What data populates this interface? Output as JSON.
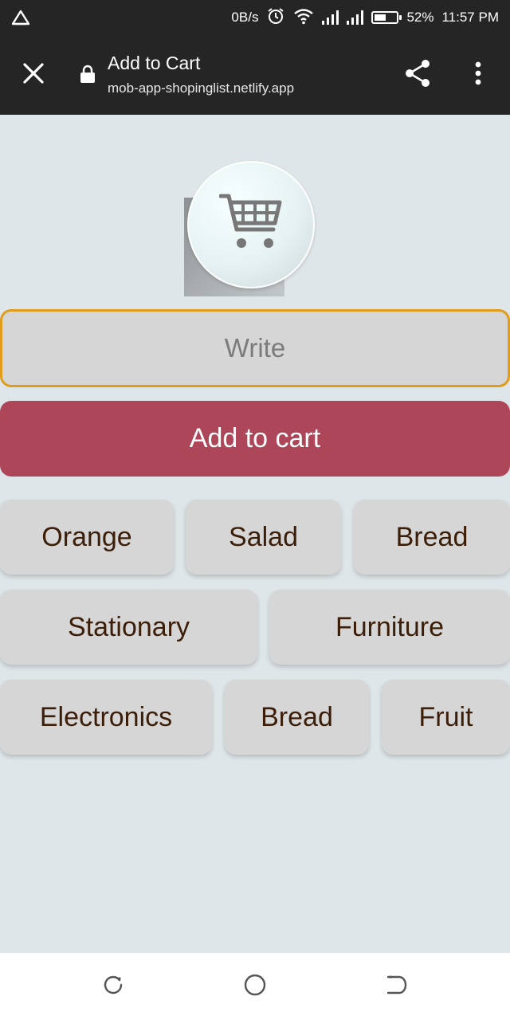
{
  "status_bar": {
    "net_speed": "0B/s",
    "battery": "52%",
    "battery_level": 0.52,
    "time": "11:57 PM",
    "icons": [
      "app-triangle-icon",
      "alarm-icon",
      "wifi-icon",
      "signal-1-icon",
      "signal-2-icon",
      "battery-icon"
    ]
  },
  "toolbar": {
    "title": "Add to Cart",
    "url": "mob-app-shopinglist.netlify.app",
    "icons": [
      "close-icon",
      "lock-icon",
      "share-icon",
      "more-vert-icon"
    ]
  },
  "logo": {
    "icon": "shopping-cart-icon"
  },
  "input": {
    "placeholder": "Write",
    "value": ""
  },
  "add_button": {
    "label": "Add to cart",
    "color": "#ad4659"
  },
  "chips": [
    {
      "label": "Orange"
    },
    {
      "label": "Salad"
    },
    {
      "label": "Bread"
    },
    {
      "label": "Stationary"
    },
    {
      "label": "Furniture"
    },
    {
      "label": "Electronics"
    },
    {
      "label": "Bread"
    },
    {
      "label": "Fruit"
    }
  ],
  "nav": {
    "icons": [
      "recent-apps-icon",
      "home-icon",
      "back-icon"
    ]
  },
  "colors": {
    "background": "#dfe6e9",
    "chip": "#d6d6d6",
    "chip_text": "#3c1e08",
    "input_border": "#e09c1b",
    "bars": "#252525"
  }
}
